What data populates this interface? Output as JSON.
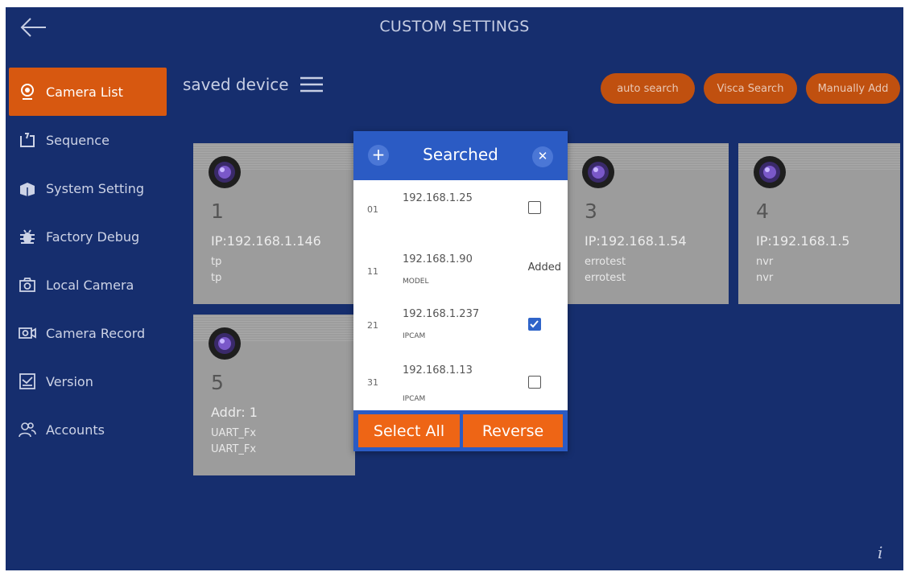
{
  "header": {
    "title": "CUSTOM SETTINGS",
    "back_icon": "arrow-left-icon"
  },
  "sidebar": {
    "items": [
      {
        "label": "Camera List",
        "icon": "webcam-icon",
        "active": true
      },
      {
        "label": "Sequence",
        "icon": "sequence-icon",
        "active": false
      },
      {
        "label": "System Setting",
        "icon": "box-icon",
        "active": false
      },
      {
        "label": "Factory Debug",
        "icon": "bug-icon",
        "active": false
      },
      {
        "label": "Local Camera",
        "icon": "camera-icon",
        "active": false
      },
      {
        "label": "Camera Record",
        "icon": "record-icon",
        "active": false
      },
      {
        "label": "Version",
        "icon": "version-icon",
        "active": false
      },
      {
        "label": "Accounts",
        "icon": "users-icon",
        "active": false
      }
    ]
  },
  "toolbar": {
    "saved_device_label": "saved device",
    "auto_search": "auto search",
    "visca_search": "Visca Search",
    "manually_add": "Manually Add"
  },
  "cards": [
    {
      "number": "1",
      "ip": "IP:192.168.1.146",
      "line1": "tp",
      "line2": "tp"
    },
    {
      "number": "3",
      "ip": "IP:192.168.1.54",
      "line1": "errotest",
      "line2": "errotest"
    },
    {
      "number": "4",
      "ip": "IP:192.168.1.5",
      "line1": "nvr",
      "line2": "nvr"
    },
    {
      "number": "5",
      "ip": "Addr: 1",
      "line1": "UART_Fx",
      "line2": "UART_Fx"
    }
  ],
  "dialog": {
    "title": "Searched",
    "rows": [
      {
        "index": "01",
        "ip": "192.168.1.25",
        "model": "",
        "status": "",
        "checked": false
      },
      {
        "index": "11",
        "ip": "192.168.1.90",
        "model": "MODEL",
        "status": "Added",
        "checked": false
      },
      {
        "index": "21",
        "ip": "192.168.1.237",
        "model": "IPCAM",
        "status": "",
        "checked": true
      },
      {
        "index": "31",
        "ip": "192.168.1.13",
        "model": "IPCAM",
        "status": "",
        "checked": false
      }
    ],
    "select_all": "Select All",
    "reverse": "Reverse"
  },
  "info_glyph": "i",
  "colors": {
    "background": "#162e6e",
    "accent": "#d75810",
    "dialog_header": "#2b5bc4",
    "button": "#ee6515"
  }
}
